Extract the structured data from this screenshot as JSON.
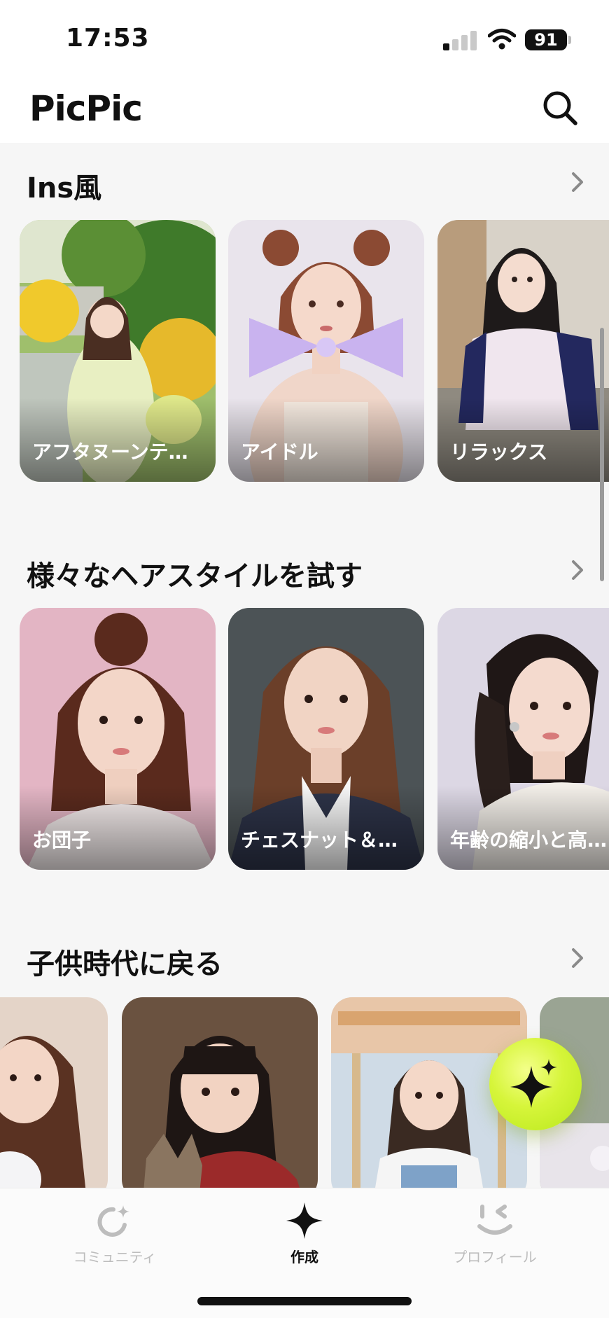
{
  "status_bar": {
    "time": "17:53",
    "battery": "91"
  },
  "header": {
    "title": "PicPic",
    "search_icon": "search-icon"
  },
  "sections": [
    {
      "title": "Ins風",
      "cards": [
        {
          "label": "アフタヌーンテ…"
        },
        {
          "label": "アイドル"
        },
        {
          "label": "リラックス"
        }
      ]
    },
    {
      "title": "様々なヘアスタイルを試す",
      "cards": [
        {
          "label": "お団子"
        },
        {
          "label": "チェスナット＆…"
        },
        {
          "label": "年齢の縮小と高…"
        }
      ]
    },
    {
      "title": "子供時代に戻る",
      "cards": []
    }
  ],
  "fab": {
    "icon": "sparkle-icon"
  },
  "tab_bar": {
    "items": [
      {
        "label": "コミュニティ",
        "icon": "community-icon",
        "active": false
      },
      {
        "label": "作成",
        "icon": "sparkle-icon",
        "active": true
      },
      {
        "label": "プロフィール",
        "icon": "profile-icon",
        "active": false
      }
    ]
  },
  "colors": {
    "accent": "#c8f02a",
    "background": "#f6f6f6",
    "text": "#111111",
    "inactive": "#bdbdbd"
  }
}
